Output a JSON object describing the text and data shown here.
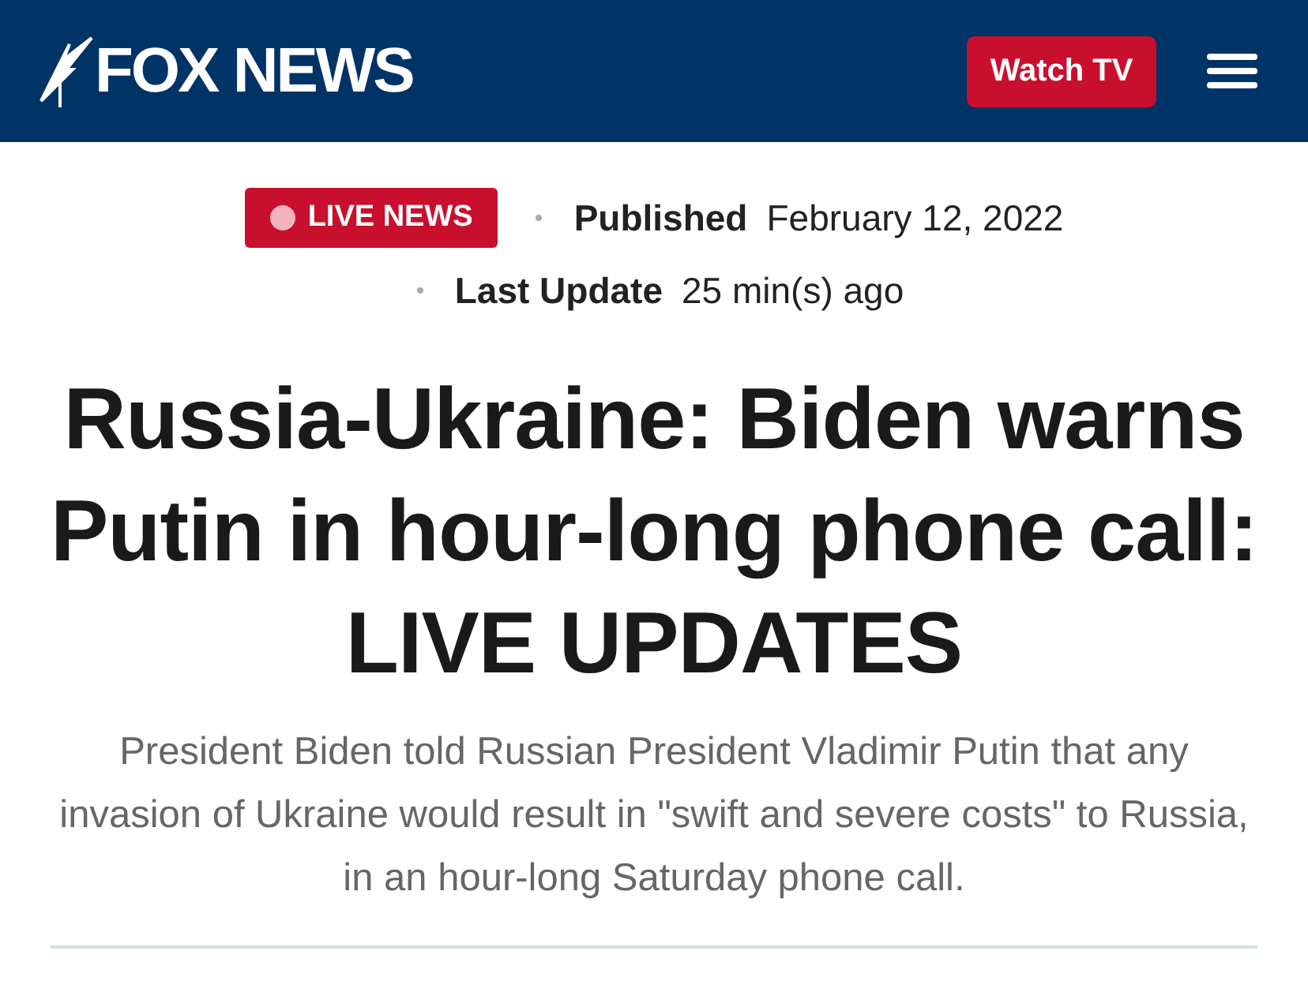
{
  "header": {
    "logo": "FOX NEWS",
    "watch_button": "Watch TV"
  },
  "meta": {
    "badge": "LIVE NEWS",
    "published_label": "Published",
    "published_date": "February 12, 2022",
    "updated_label": "Last Update",
    "updated_value": "25 min(s) ago"
  },
  "headline": "Russia-Ukraine: Biden warns Putin in hour-long phone call: LIVE UPDATES",
  "summary": "President Biden told Russian President Vladimir Putin that any invasion of Ukraine would result in \"swift and severe costs\" to Russia, in an hour-long Saturday phone call."
}
